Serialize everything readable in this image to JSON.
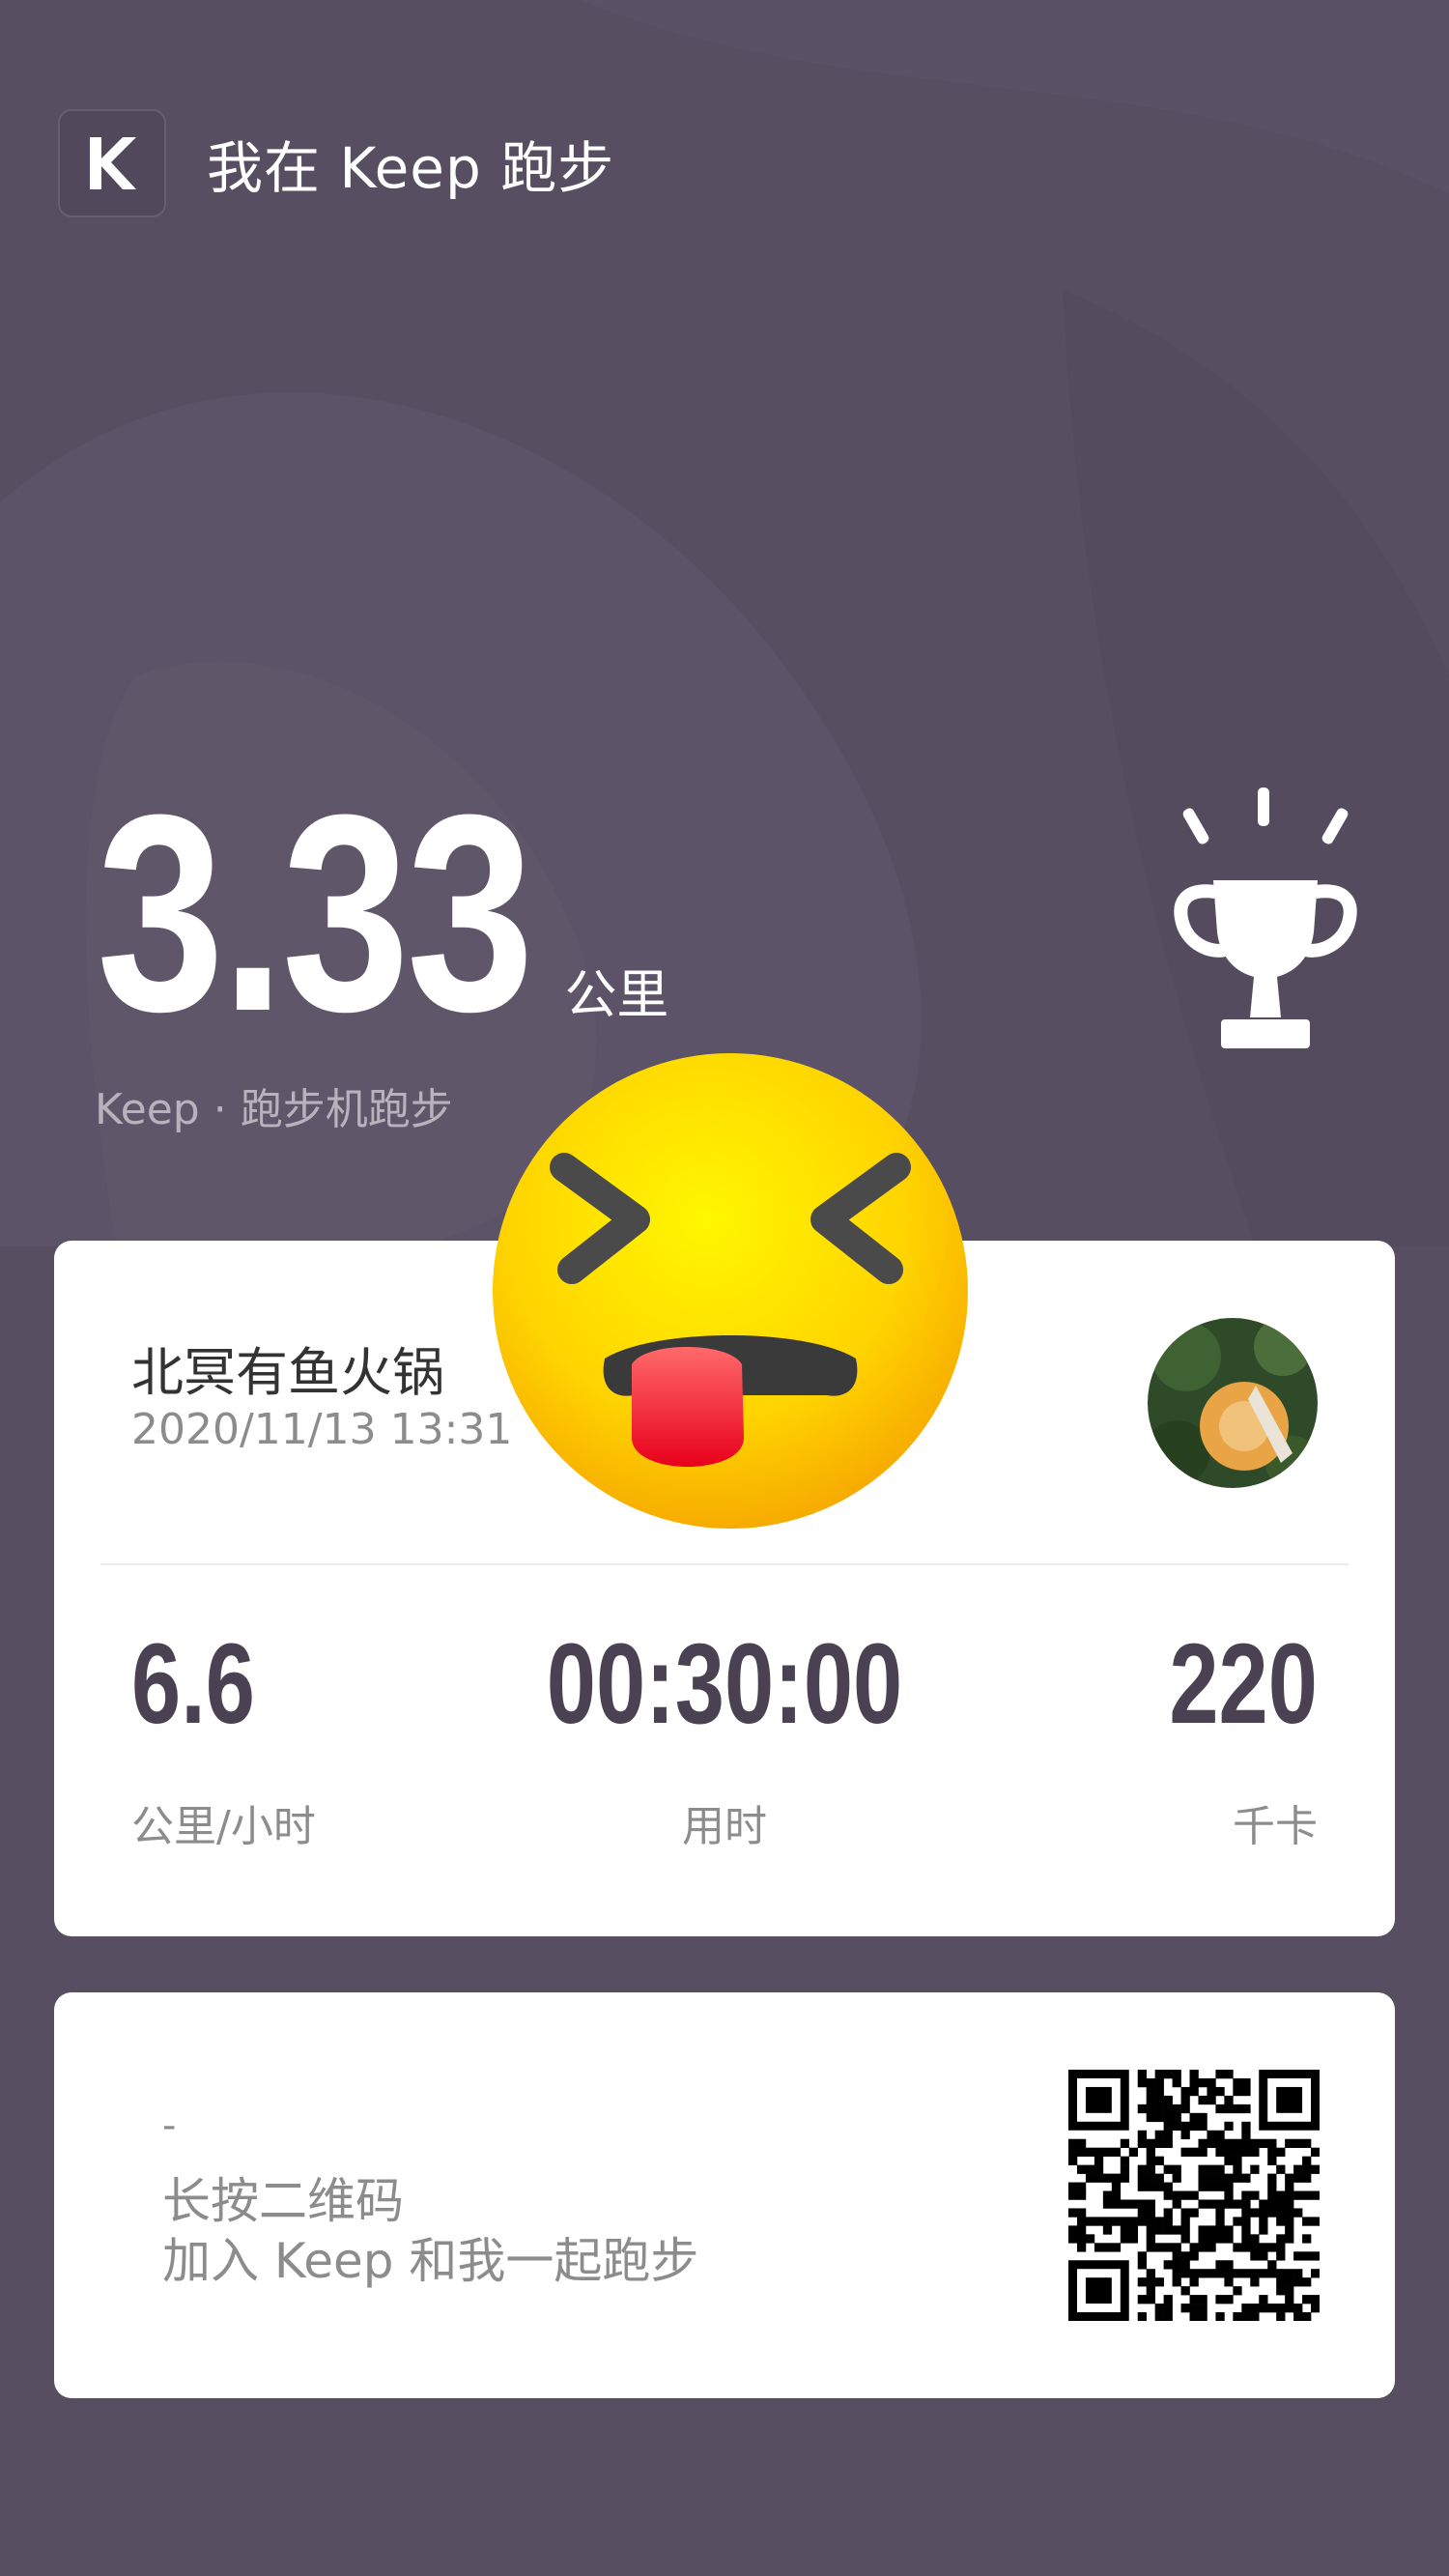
{
  "header": {
    "title": "我在 Keep 跑步",
    "logo_icon": "keep-k-logo-icon"
  },
  "summary": {
    "distance": "3.33",
    "distance_unit": "公里",
    "sport": "Keep · 跑步机跑步",
    "badge_icon": "trophy-icon"
  },
  "card": {
    "place": "北冥有鱼火锅",
    "datetime": "2020/11/13 13:31",
    "stats": [
      {
        "value": "6.6",
        "label": "公里/小时"
      },
      {
        "value": "00:30:00",
        "label": "用时"
      },
      {
        "value": "220",
        "label": "千卡"
      }
    ]
  },
  "invite": {
    "dash": "-",
    "line1": "长按二维码",
    "line2": "加入 Keep 和我一起跑步"
  },
  "colors": {
    "background": "#584e62",
    "card": "#ffffff",
    "stat_value": "#4a4252",
    "muted": "#8c8c8c"
  }
}
